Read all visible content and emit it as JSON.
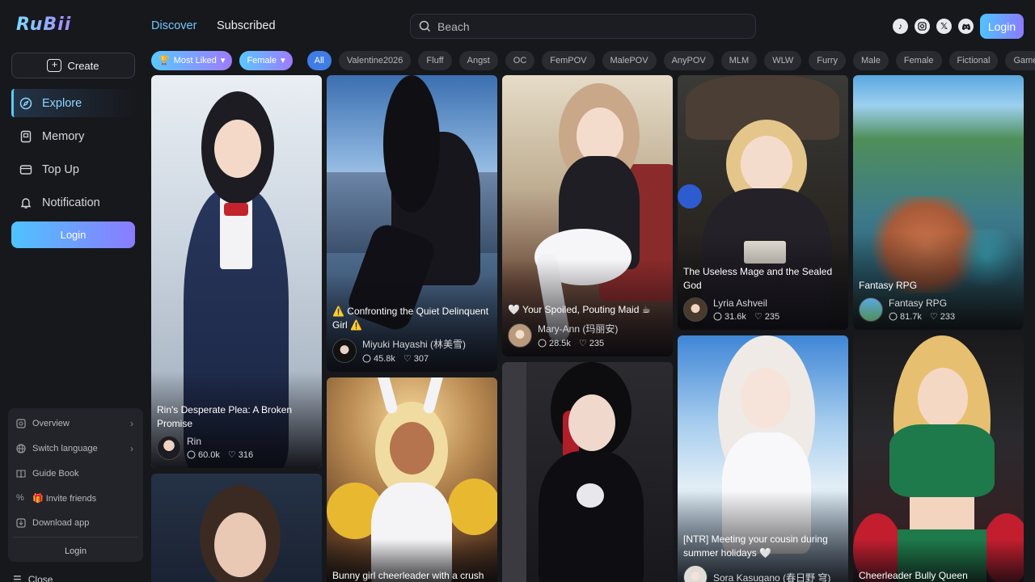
{
  "app": {
    "logo": "RuBii"
  },
  "sidebar": {
    "create_label": "Create",
    "nav": [
      {
        "label": "Explore",
        "icon": "compass-icon",
        "active": true
      },
      {
        "label": "Memory",
        "icon": "memory-icon",
        "active": false
      },
      {
        "label": "Top Up",
        "icon": "wallet-icon",
        "active": false
      },
      {
        "label": "Notification",
        "icon": "bell-icon",
        "active": false
      }
    ],
    "login_label": "Login",
    "panel": [
      {
        "label": "Overview",
        "icon": "overview-icon",
        "chevron": true
      },
      {
        "label": "Switch language",
        "icon": "globe-icon",
        "chevron": true
      },
      {
        "label": "Guide Book",
        "icon": "book-icon",
        "chevron": false
      },
      {
        "label": "🎁 Invite friends",
        "icon": "percent-icon",
        "chevron": false
      },
      {
        "label": "Download app",
        "icon": "download-icon",
        "chevron": false
      }
    ],
    "panel_login": "Login",
    "close_label": "Close"
  },
  "header": {
    "tabs": [
      {
        "label": "Discover",
        "active": true
      },
      {
        "label": "Subscribed",
        "active": false
      }
    ],
    "search_placeholder": "Beach",
    "socials": [
      "tiktok-icon",
      "instagram-icon",
      "x-icon",
      "discord-icon"
    ],
    "login_label": "Login"
  },
  "filters": {
    "sort": "Most Liked",
    "gender": "Female",
    "tags": [
      "All",
      "Valentine2026",
      "Fluff",
      "Angst",
      "OC",
      "FemPOV",
      "MalePOV",
      "AnyPOV",
      "MLM",
      "WLW",
      "Furry",
      "Male",
      "Female",
      "Fictional",
      "Game"
    ]
  },
  "cards": [
    {
      "title": "Rin's Desperate Plea: A Broken Promise",
      "author": "Rin",
      "chats": "60.0k",
      "likes": "316"
    },
    {
      "title": "⚠️ Confronting the Quiet Delinquent Girl ⚠️",
      "author": "Miyuki Hayashi (林美雪)",
      "chats": "45.8k",
      "likes": "307"
    },
    {
      "title": "🤍 Your Spoiled, Pouting Maid ☕",
      "author": "Mary-Ann (玛丽安)",
      "chats": "28.5k",
      "likes": "235"
    },
    {
      "title": "The Useless Mage and the Sealed God",
      "author": "Lyria Ashveil",
      "chats": "31.6k",
      "likes": "235"
    },
    {
      "title": "Fantasy RPG",
      "author": "Fantasy RPG",
      "chats": "81.7k",
      "likes": "233"
    },
    {
      "title": "Bunny girl cheerleader with a crush"
    },
    {
      "title": "[NTR] Meeting your cousin during summer holidays 🤍",
      "author": "Sora Kasugano (春日野 穹)"
    },
    {
      "title": "Cheerleader Bully Queen"
    }
  ],
  "colors": {
    "accent": "#4fc3ff",
    "accent2": "#8b7bff",
    "background": "#17181c"
  }
}
